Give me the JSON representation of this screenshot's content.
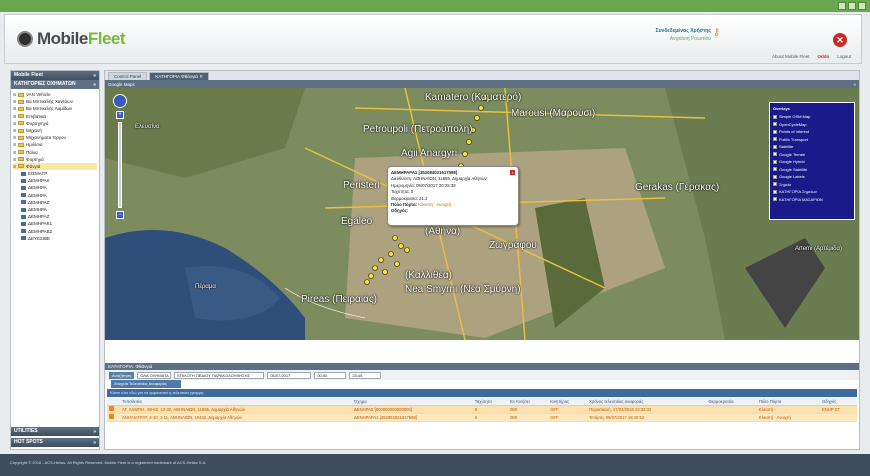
{
  "app": {
    "logo_mobile": "Mobile",
    "logo_fleet": "Fleet"
  },
  "header": {
    "user_label": "Συνδεδεμένος Χρήστης",
    "user_name": "Ανφάλοη Ροωπίου",
    "about": "About Mobile Fleet",
    "help": "Oddo",
    "logout": "Logout"
  },
  "sidebar": {
    "title": "Mobile Fleet",
    "section": "ΚΑΤΗΓΟΡΙΕΣ ΟΧΗΜΑΤΩΝ",
    "items": [
      {
        "label": "VAN Vehicle",
        "type": "folder"
      },
      {
        "label": "Βα Μπτικελής Χαντάων",
        "type": "folder"
      },
      {
        "label": "Βα Μπτικελής Λαμίδων",
        "type": "folder"
      },
      {
        "label": "Επιβατικά",
        "type": "folder"
      },
      {
        "label": "Φορτηγηγά",
        "type": "folder"
      },
      {
        "label": "Μηχανή",
        "type": "folder"
      },
      {
        "label": "Μηχανήματα Έργου",
        "type": "folder"
      },
      {
        "label": "Ημιλίσια",
        "type": "folder"
      },
      {
        "label": "Πάλια",
        "type": "folder"
      },
      {
        "label": "Φορτηγά",
        "type": "folder"
      },
      {
        "label": "Φάνγιά",
        "type": "folder",
        "selected": true
      },
      {
        "label": "ΕΙΣΜΑΤΡ",
        "type": "car"
      },
      {
        "label": "ΔΕΜΗΡΑΚ",
        "type": "car"
      },
      {
        "label": "ΔΕΜΗΡΑ",
        "type": "car"
      },
      {
        "label": "ΔΕΜΗΡΑ",
        "type": "car"
      },
      {
        "label": "ΔΕΜΗΡΑΖ",
        "type": "car"
      },
      {
        "label": "ΔΕΜΗΡΑ",
        "type": "car"
      },
      {
        "label": "ΔΕΜΗΡΑΖ",
        "type": "car"
      },
      {
        "label": "ΔΕΜΗΡΑΚ1",
        "type": "car"
      },
      {
        "label": "ΔΕΜΗΡΑΒ2",
        "type": "car"
      },
      {
        "label": "ΔΕΥΕΣΙΒΕ",
        "type": "car"
      }
    ],
    "utilities": "UTILITIES",
    "hotspots": "HOT SPOTS"
  },
  "tabs": [
    {
      "label": "Control Panel"
    },
    {
      "label": "ΚΑΤΗΓΟΡΙΑ Φθάνγιά"
    }
  ],
  "map": {
    "title": "Google Maps",
    "labels": {
      "kamatero": "Kamatero (Καματερό)",
      "petroupoli": "Petroupoli (Πετρούπολη)",
      "agii": "Agii Anargyri",
      "marousi": "Marousi (Μαρούσι)",
      "peristeri": "Peristeri",
      "egaleo": "Egaleo",
      "athina": "(Αθήνα)",
      "zografou": "Ζωγράφου",
      "kallithea": "(Καλλιθέα)",
      "nea_smyrni": "Nea Smyrni (Νέα Σμύρνη)",
      "pireas": "Pireas (Πειραιάς)",
      "gerakas": "Gerakas (Γέρακας)",
      "artemi": "Artemi (Αρτέμιδα)",
      "perama": "Πέραμα",
      "elefsina": "Ελευσίνα"
    },
    "info": {
      "title": "ΔΕΜΗΡΑΡΑ1 [352084021617598]",
      "address": "Διεύθυνση: ΑΘΗΝΑΪΩΝ, 11855, Δημαρχία Αθηνών",
      "date": "Ημερομηνία: 05/07/2017 20:25:38",
      "speed": "Ταχύτητα: 0",
      "fuel": "Θερμοκρασία: 21.2",
      "ignition_label": "Πόλο Πόρτα:",
      "ignition_value": "Κλειστή - Ανοιχτή",
      "driver": "Οδηγός:"
    },
    "overlays": {
      "title": "Overlays",
      "items": [
        "Simple OSM Map",
        "OpenCycleMap",
        "Points of Interest",
        "Public Transport",
        "Satellite",
        "Google Terrain",
        "Google Hybrid",
        "Google Satellite",
        "Google Labels",
        "Σημεία",
        "ΚΑΤΗΓΟΡΙΑ Σημείων",
        "ΚΑΤΗΓΟΡΙΑ ΜΑΣΑΡΙΩΝ"
      ]
    }
  },
  "bottom": {
    "title": "ΚΑΤΗΓΟΡΙΑ: Φθάνγιά",
    "toolbar": {
      "btn": "Αναζήτηση",
      "select1": "ΟΛΑ ΟΧΗΜΑΤΑ",
      "select2": "ΕΠΙΛΟΓΗ ΠΕΔΙΟΥ ΠΑΡΑΚΟΛΟΥΘΗΣΗΣ",
      "date": "05/07/2017",
      "time1": "00:00",
      "time2": "23:45"
    },
    "subtab": "Στοιχεία Τελευταίας Αναφοράς",
    "bluebar": "Κάντε κλικ εδώ για να εμφανιστεί η τελευταία γραμμή",
    "columns": [
      "",
      "Τοποθεσία",
      "Όχημα",
      "Ταχύτητα",
      "Εν Κινήσει",
      "Κινητήρας",
      "Χρόνος τελευταίας αναφοράς",
      "Θερμοκρασία",
      "Πόλο Πόρτα",
      "Οδηγός"
    ],
    "rows": [
      [
        "",
        "ΑΓ. ΛΑΜΠΗ , 60-62, 13-32, ΑΘΗΝΑΙΩΝ, 11855, Δημαρχία Αθηνών",
        "ΔΕΝΗΡΑΣ [000000000000000]",
        "0",
        "000",
        "OFF",
        "Παρασκευή, 17/04/2015 22:32:32",
        "",
        "Κλειστή -",
        "ΕΝΗΡ ΣΤ"
      ],
      [
        "",
        "ΑΝΗΛΙΑΤΡΑΤ, 2-10, 1-11, ΑΘΗΝΑΙΩΝ, 10442, Δημαρχία Αθηνών",
        "ΔΕΝΗΡΑΡΑ1 [352084021617598]",
        "0",
        "000",
        "OFF",
        "Τετάρτη, 05/07/2017 18:20:52",
        "",
        "Κλειστή - Ανοιχτή",
        ""
      ]
    ]
  },
  "footer": "Copyright © 2016 - ACS-Hellas. All Rights Reserved. Mobile Fleet is a registered trademark of ACS-Hellas S.A."
}
